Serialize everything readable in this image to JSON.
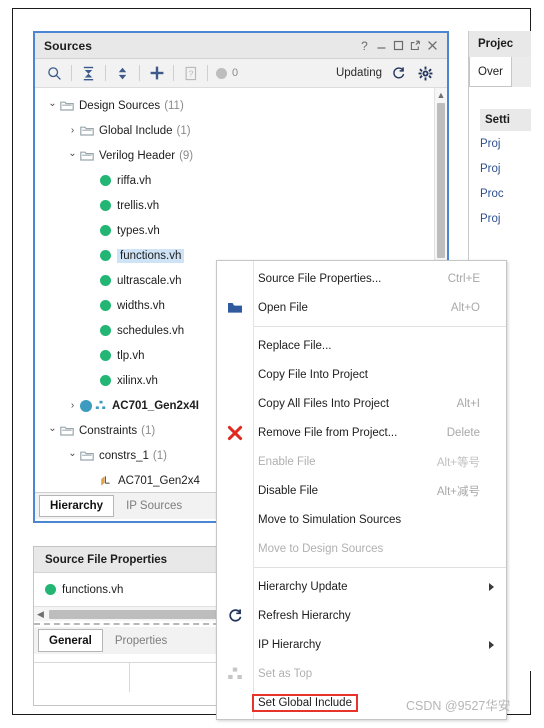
{
  "sources_window": {
    "title": "Sources",
    "controls": [
      {
        "name": "help-icon",
        "glyph": "?"
      },
      {
        "name": "minimize-icon",
        "glyph": "_"
      },
      {
        "name": "maximize-icon",
        "glyph": "□"
      },
      {
        "name": "float-icon",
        "glyph": "❐"
      },
      {
        "name": "close-icon",
        "glyph": "✕"
      }
    ],
    "toolbar": {
      "search_label": "search-icon",
      "collapse_all_label": "collapse-all-icon",
      "expand_all_label": "expand-collapse-icon",
      "add_sources_label": "add-sources-icon",
      "report_label": "report-icon",
      "count": "0",
      "status": "Updating",
      "refresh_label": "refresh-icon",
      "settings_label": "gear-icon"
    },
    "tree": [
      {
        "indent": 0,
        "twisty": "⌄",
        "kind": "folder",
        "label": "Design Sources",
        "count": "(11)",
        "selected": false,
        "bold": false
      },
      {
        "indent": 1,
        "twisty": "›",
        "kind": "folder",
        "label": "Global Include",
        "count": "(1)",
        "selected": false,
        "bold": false
      },
      {
        "indent": 1,
        "twisty": "⌄",
        "kind": "folder",
        "label": "Verilog Header",
        "count": "(9)",
        "selected": false,
        "bold": false
      },
      {
        "indent": 2,
        "twisty": "",
        "kind": "file",
        "label": "riffa.vh",
        "count": "",
        "selected": false,
        "bold": false
      },
      {
        "indent": 2,
        "twisty": "",
        "kind": "file",
        "label": "trellis.vh",
        "count": "",
        "selected": false,
        "bold": false
      },
      {
        "indent": 2,
        "twisty": "",
        "kind": "file",
        "label": "types.vh",
        "count": "",
        "selected": false,
        "bold": false
      },
      {
        "indent": 2,
        "twisty": "",
        "kind": "file",
        "label": "functions.vh",
        "count": "",
        "selected": true,
        "bold": false
      },
      {
        "indent": 2,
        "twisty": "",
        "kind": "file",
        "label": "ultrascale.vh",
        "count": "",
        "selected": false,
        "bold": false
      },
      {
        "indent": 2,
        "twisty": "",
        "kind": "file",
        "label": "widths.vh",
        "count": "",
        "selected": false,
        "bold": false
      },
      {
        "indent": 2,
        "twisty": "",
        "kind": "file",
        "label": "schedules.vh",
        "count": "",
        "selected": false,
        "bold": false
      },
      {
        "indent": 2,
        "twisty": "",
        "kind": "file",
        "label": "tlp.vh",
        "count": "",
        "selected": false,
        "bold": false
      },
      {
        "indent": 2,
        "twisty": "",
        "kind": "file",
        "label": "xilinx.vh",
        "count": "",
        "selected": false,
        "bold": false
      },
      {
        "indent": 1,
        "twisty": "›",
        "kind": "module",
        "label": "AC701_Gen2x4I",
        "count": "",
        "selected": false,
        "bold": true
      },
      {
        "indent": 0,
        "twisty": "⌄",
        "kind": "folder",
        "label": "Constraints",
        "count": "(1)",
        "selected": false,
        "bold": false
      },
      {
        "indent": 1,
        "twisty": "⌄",
        "kind": "folder",
        "label": "constrs_1",
        "count": "(1)",
        "selected": false,
        "bold": false
      },
      {
        "indent": 2,
        "twisty": "",
        "kind": "constraint",
        "label": "AC701_Gen2x4",
        "count": "",
        "selected": false,
        "bold": false
      }
    ],
    "tabs": [
      {
        "label": "Hierarchy",
        "active": true
      },
      {
        "label": "IP Sources",
        "active": false
      }
    ]
  },
  "properties_window": {
    "title": "Source File Properties",
    "file": "functions.vh",
    "tabs": [
      {
        "label": "General",
        "active": true
      },
      {
        "label": "Properties",
        "active": false
      }
    ]
  },
  "right_panel": {
    "title": "Projec",
    "tab": "Over",
    "section": "Setti",
    "lines": [
      "Proj",
      "Proj",
      "Proc",
      "Proj"
    ]
  },
  "context_menu": {
    "items": [
      {
        "label": "Source File Properties...",
        "accel": "Ctrl+E",
        "icon": "",
        "disabled": false,
        "submenu": false,
        "highlight": false,
        "separator_after": false
      },
      {
        "label": "Open File",
        "accel": "Alt+O",
        "icon": "open-folder-icon",
        "disabled": false,
        "submenu": false,
        "highlight": false,
        "separator_after": true
      },
      {
        "label": "Replace File...",
        "accel": "",
        "icon": "",
        "disabled": false,
        "submenu": false,
        "highlight": false,
        "separator_after": false
      },
      {
        "label": "Copy File Into Project",
        "accel": "",
        "icon": "",
        "disabled": false,
        "submenu": false,
        "highlight": false,
        "separator_after": false
      },
      {
        "label": "Copy All Files Into Project",
        "accel": "Alt+I",
        "icon": "",
        "disabled": false,
        "submenu": false,
        "highlight": false,
        "separator_after": false
      },
      {
        "label": "Remove File from Project...",
        "accel": "Delete",
        "icon": "remove-x-icon",
        "disabled": false,
        "submenu": false,
        "highlight": false,
        "separator_after": false
      },
      {
        "label": "Enable File",
        "accel": "Alt+等号",
        "icon": "",
        "disabled": true,
        "submenu": false,
        "highlight": false,
        "separator_after": false
      },
      {
        "label": "Disable File",
        "accel": "Alt+减号",
        "icon": "",
        "disabled": false,
        "submenu": false,
        "highlight": false,
        "separator_after": false
      },
      {
        "label": "Move to Simulation Sources",
        "accel": "",
        "icon": "",
        "disabled": false,
        "submenu": false,
        "highlight": false,
        "separator_after": false
      },
      {
        "label": "Move to Design Sources",
        "accel": "",
        "icon": "",
        "disabled": true,
        "submenu": false,
        "highlight": false,
        "separator_after": true
      },
      {
        "label": "Hierarchy Update",
        "accel": "",
        "icon": "",
        "disabled": false,
        "submenu": true,
        "highlight": false,
        "separator_after": false
      },
      {
        "label": "Refresh Hierarchy",
        "accel": "",
        "icon": "refresh-icon",
        "disabled": false,
        "submenu": false,
        "highlight": false,
        "separator_after": false
      },
      {
        "label": "IP Hierarchy",
        "accel": "",
        "icon": "",
        "disabled": false,
        "submenu": true,
        "highlight": false,
        "separator_after": false
      },
      {
        "label": "Set as Top",
        "accel": "",
        "icon": "set-as-top-icon",
        "disabled": true,
        "submenu": false,
        "highlight": false,
        "separator_after": false
      },
      {
        "label": "Set Global Include",
        "accel": "",
        "icon": "",
        "disabled": false,
        "submenu": false,
        "highlight": true,
        "separator_after": false
      }
    ]
  },
  "watermark": {
    "text": "CSDN @9527华安"
  },
  "colors": {
    "accent_blue": "#4a86d4",
    "green_dot": "#22b573",
    "highlight_red": "#e8332a",
    "selection_blue": "#cfe3f7"
  }
}
